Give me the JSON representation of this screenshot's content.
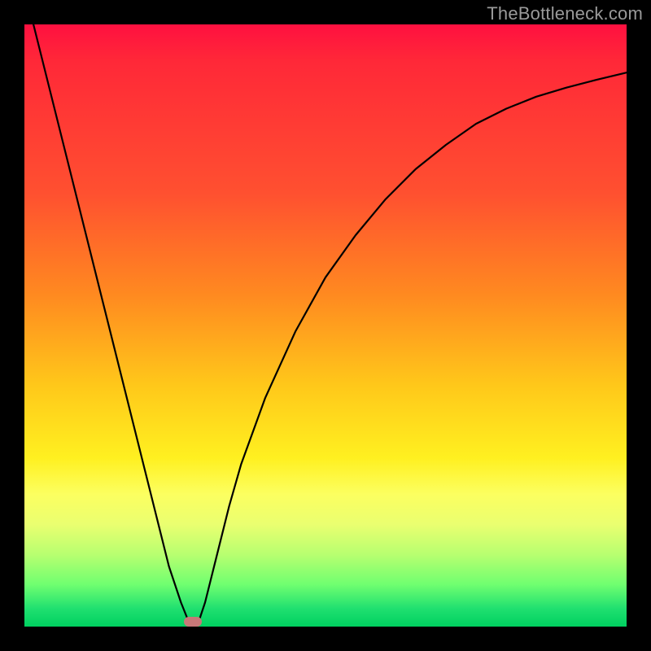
{
  "watermark": "TheBottleneck.com",
  "colors": {
    "frame": "#000000",
    "curve_stroke": "#000000",
    "marker_fill": "#c77878",
    "gradient_top": "#ff1040",
    "gradient_bottom": "#00d060"
  },
  "chart_data": {
    "type": "line",
    "title": "",
    "xlabel": "",
    "ylabel": "",
    "xlim": [
      0,
      100
    ],
    "ylim": [
      0,
      100
    ],
    "grid": false,
    "legend": false,
    "annotations": [
      "TheBottleneck.com"
    ],
    "series": [
      {
        "name": "bottleneck-curve",
        "x": [
          0,
          4,
          8,
          12,
          16,
          20,
          22,
          24,
          26,
          27,
          28,
          29,
          30,
          32,
          34,
          36,
          40,
          45,
          50,
          55,
          60,
          65,
          70,
          75,
          80,
          85,
          90,
          95,
          100
        ],
        "values": [
          106,
          90,
          74,
          58,
          42,
          26,
          18,
          10,
          4,
          1.5,
          0,
          1,
          4,
          12,
          20,
          27,
          38,
          49,
          58,
          65,
          71,
          76,
          80,
          83.5,
          86,
          88,
          89.5,
          90.8,
          92
        ]
      }
    ],
    "marker": {
      "x": 28,
      "y": 0
    }
  }
}
